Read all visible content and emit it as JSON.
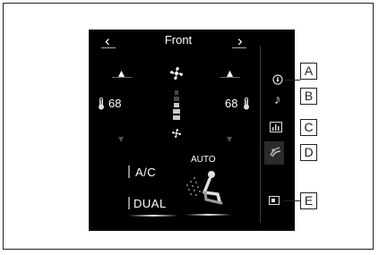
{
  "header": {
    "title": "Front",
    "prev_icon": "chevron-left-icon",
    "next_icon": "chevron-right-icon"
  },
  "left_zone": {
    "temperature": "68",
    "temp_up_icon": "caret-up-icon",
    "temp_down_icon": "caret-down-icon",
    "thermometer_icon": "thermometer-icon"
  },
  "right_zone": {
    "temperature": "68",
    "temp_up_icon": "caret-up-icon",
    "temp_down_icon": "caret-down-icon",
    "thermometer_icon": "thermometer-icon"
  },
  "fan": {
    "fan_icon": "fan-icon",
    "fan_down_icon": "fan-small-icon",
    "level_segments_total": 5,
    "level_segments_on": 3
  },
  "buttons": {
    "ac_label": "A/C",
    "dual_label": "DUAL",
    "auto_label": "AUTO"
  },
  "side_menu": {
    "items": [
      {
        "icon": "radio-icon",
        "callout": "A"
      },
      {
        "icon": "music-note-icon",
        "callout": "B"
      },
      {
        "icon": "equalizer-icon",
        "callout": "C"
      },
      {
        "icon": "climate-icon",
        "callout": "D"
      },
      {
        "icon": "display-icon",
        "callout": "E"
      }
    ]
  },
  "colors": {
    "screen_bg": "#000000",
    "text": "#ffffff",
    "fan_level_on": "#c8c8c8",
    "fan_level_off": "#4a4a4a"
  }
}
